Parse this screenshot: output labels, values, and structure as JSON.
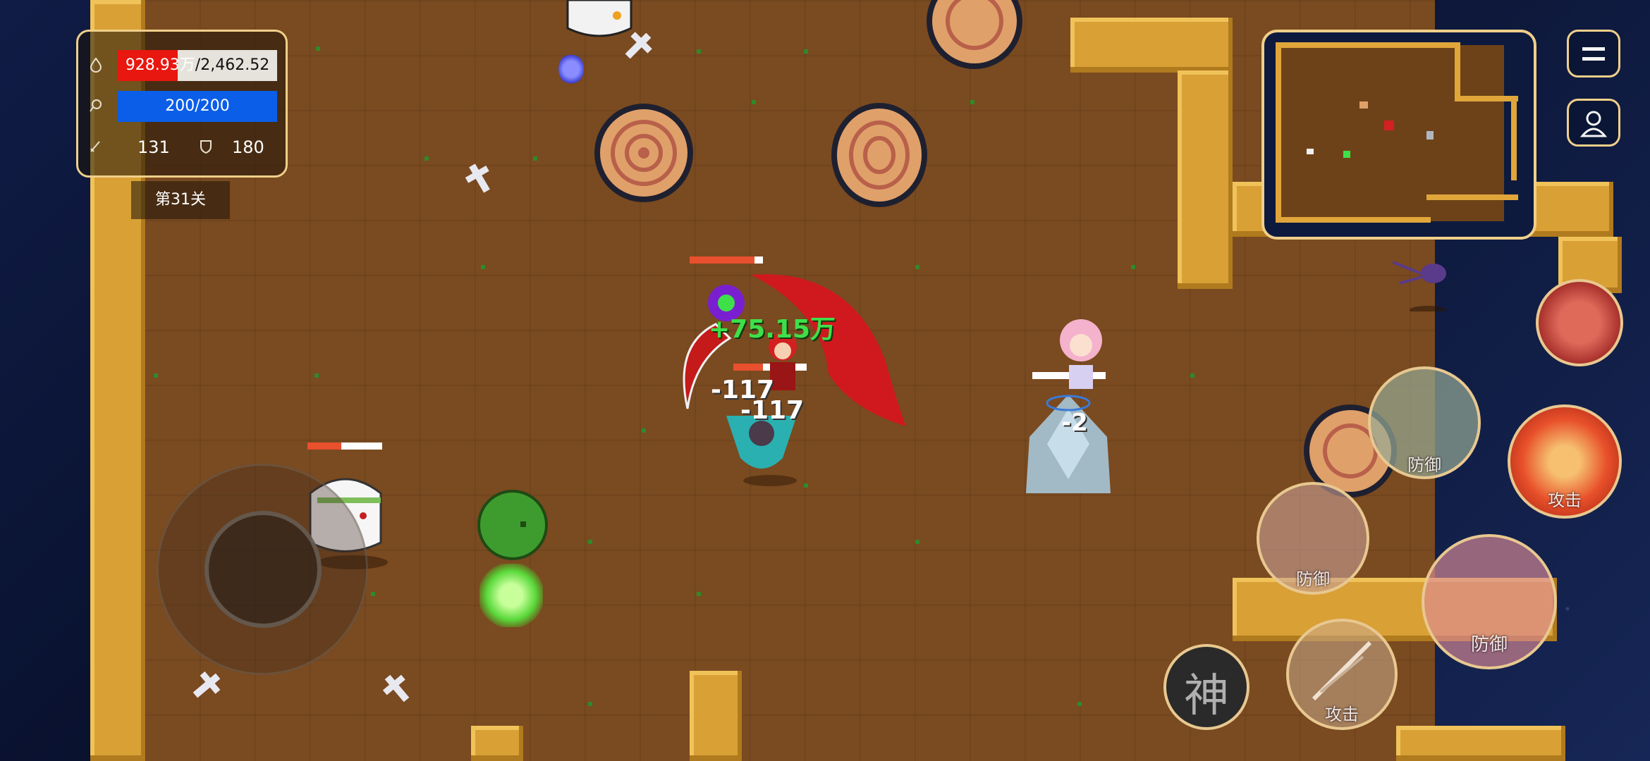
{
  "hud": {
    "hp": {
      "current": "928.93万",
      "separator": "/",
      "max": "2,462.52",
      "fill_fraction": 0.377
    },
    "mp": {
      "text": "200/200",
      "fill_fraction": 1.0
    },
    "attack": "131",
    "defense": "180",
    "stage": "第31关",
    "icons": {
      "hp": "blood-drop-icon",
      "mp": "mana-icon",
      "attack": "sword-icon",
      "defense": "shield-icon"
    }
  },
  "battle_text": {
    "heal": "+75.15万",
    "damage_1": "-117",
    "damage_2": "-117",
    "damage_3": "-2"
  },
  "skills": {
    "god": "神",
    "attack_small": "攻击",
    "attack_main": "攻击",
    "defense_1": "防御",
    "defense_2": "防御",
    "defense_3": "防御"
  },
  "menu": {
    "menu_icon": "hamburger-icon",
    "profile_icon": "user-icon"
  },
  "colors": {
    "frame": "#f0cf8a",
    "hp_red": "#e8170f",
    "mp_blue": "#0a5ee8",
    "heal_green": "#3ee04a",
    "floor": "#7a4a20",
    "rock": "#d9a035"
  }
}
